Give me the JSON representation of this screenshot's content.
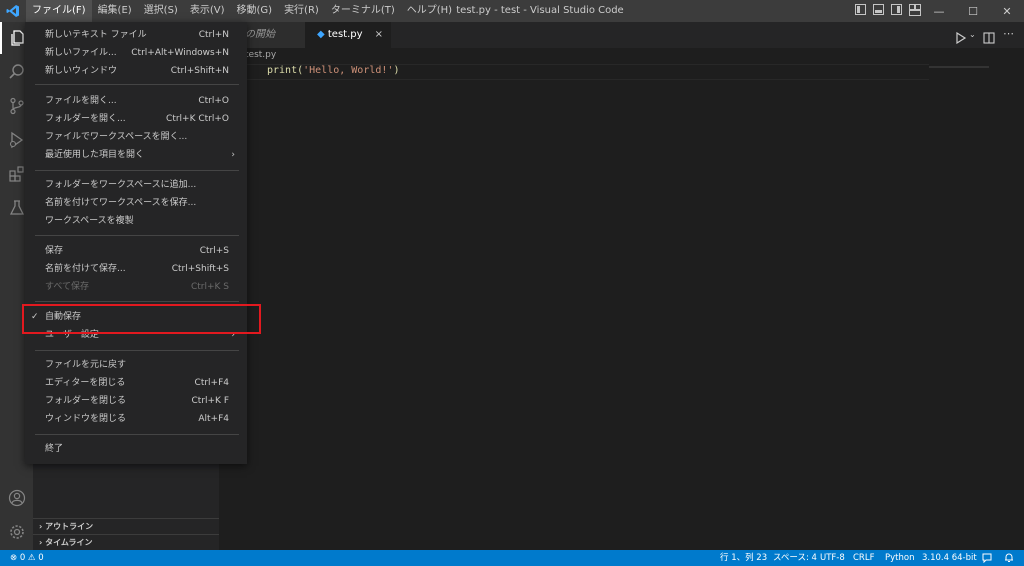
{
  "titlebar": {
    "menus": [
      "ファイル(F)",
      "編集(E)",
      "選択(S)",
      "表示(V)",
      "移動(G)",
      "実行(R)",
      "ターミナル(T)",
      "ヘルプ(H)"
    ],
    "active_menu_index": 0,
    "window_title": "test.py - test - Visual Studio Code",
    "minimize": "—",
    "maximize": "☐",
    "close": "✕"
  },
  "tabs": {
    "tab1": "作業の開始",
    "tab2": "test.py",
    "tab2_close": "×"
  },
  "breadcrumb": "test.py",
  "editor": {
    "code_fn": "print(",
    "code_str": "'Hello, World!'",
    "code_end": ")"
  },
  "sidebar": {
    "outline": "アウトライン",
    "timeline": "タイムライン"
  },
  "file_menu": {
    "new_text_file": {
      "label": "新しいテキスト ファイル",
      "shortcut": "Ctrl+N"
    },
    "new_file": {
      "label": "新しいファイル...",
      "shortcut": "Ctrl+Alt+Windows+N"
    },
    "new_window": {
      "label": "新しいウィンドウ",
      "shortcut": "Ctrl+Shift+N"
    },
    "open_file": {
      "label": "ファイルを開く...",
      "shortcut": "Ctrl+O"
    },
    "open_folder": {
      "label": "フォルダーを開く...",
      "shortcut": "Ctrl+K Ctrl+O"
    },
    "open_workspace": {
      "label": "ファイルでワークスペースを開く..."
    },
    "open_recent": {
      "label": "最近使用した項目を開く",
      "arrow": "›"
    },
    "add_folder": {
      "label": "フォルダーをワークスペースに追加..."
    },
    "save_workspace_as": {
      "label": "名前を付けてワークスペースを保存..."
    },
    "duplicate_workspace": {
      "label": "ワークスペースを複製"
    },
    "save": {
      "label": "保存",
      "shortcut": "Ctrl+S"
    },
    "save_as": {
      "label": "名前を付けて保存...",
      "shortcut": "Ctrl+Shift+S"
    },
    "save_all": {
      "label": "すべて保存",
      "shortcut": "Ctrl+K S"
    },
    "auto_save": {
      "label": "自動保存",
      "check": "✓",
      "checked": true
    },
    "preferences": {
      "label": "ユーザー設定",
      "arrow": "›"
    },
    "revert_file": {
      "label": "ファイルを元に戻す"
    },
    "close_editor": {
      "label": "エディターを閉じる",
      "shortcut": "Ctrl+F4"
    },
    "close_folder": {
      "label": "フォルダーを閉じる",
      "shortcut": "Ctrl+K F"
    },
    "close_window": {
      "label": "ウィンドウを閉じる",
      "shortcut": "Alt+F4"
    },
    "exit": {
      "label": "終了"
    }
  },
  "statusbar": {
    "problems": "⊗ 0 ⚠ 0",
    "position": "行 1、列 23",
    "spaces": "スペース: 4",
    "encoding": "UTF-8",
    "eol": "CRLF",
    "language": "Python",
    "interpreter": "3.10.4 64-bit"
  },
  "colors": {
    "accent": "#007acc",
    "highlight_box": "#e2191f",
    "code_function": "#dcdcaa",
    "code_string": "#ce9178"
  },
  "icons": [
    "vscode-logo-icon",
    "explorer-icon",
    "search-icon",
    "source-control-icon",
    "run-debug-icon",
    "extensions-icon",
    "testing-icon",
    "account-icon",
    "settings-gear-icon"
  ]
}
